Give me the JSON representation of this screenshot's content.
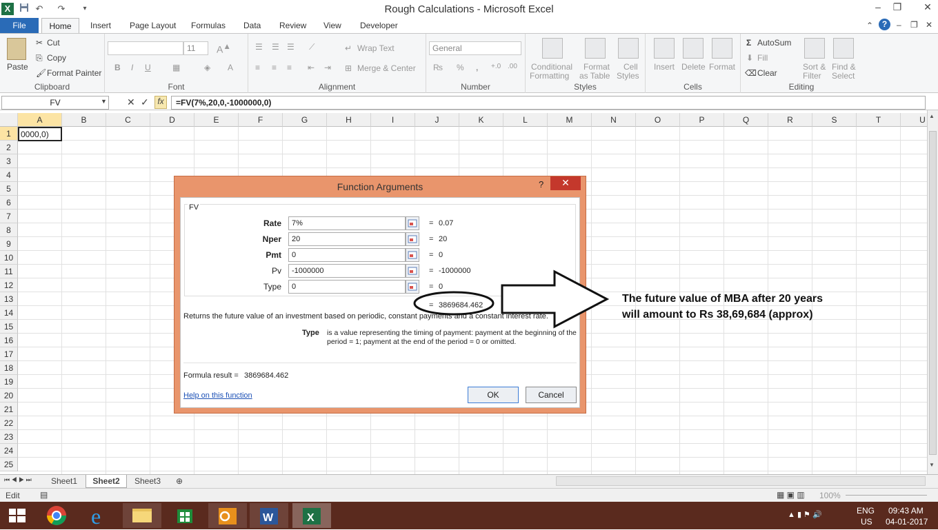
{
  "window": {
    "title": "Rough Calculations - Microsoft Excel",
    "minimize": "–",
    "restore": "❐",
    "close": "✕"
  },
  "tabs": {
    "file": "File",
    "home": "Home",
    "insert": "Insert",
    "page_layout": "Page Layout",
    "formulas": "Formulas",
    "data": "Data",
    "review": "Review",
    "view": "View",
    "developer": "Developer"
  },
  "ribbon": {
    "clipboard": {
      "paste": "Paste",
      "cut": "Cut",
      "copy": "Copy",
      "format_painter": "Format Painter",
      "label": "Clipboard"
    },
    "font": {
      "size": "11",
      "label": "Font",
      "bold": "B",
      "italic": "I",
      "underline": "U"
    },
    "alignment": {
      "wrap_text": "Wrap Text",
      "merge_center": "Merge & Center",
      "label": "Alignment"
    },
    "number": {
      "format": "General",
      "label": "Number",
      "percent": "%",
      "comma": ","
    },
    "styles": {
      "conditional": "Conditional",
      "formatting": "Formatting",
      "format_as": "Format",
      "as_table": "as Table",
      "cell": "Cell",
      "styles": "Styles",
      "label": "Styles"
    },
    "cells": {
      "insert": "Insert",
      "delete": "Delete",
      "format": "Format",
      "label": "Cells"
    },
    "editing": {
      "autosum": "AutoSum",
      "fill": "Fill",
      "clear": "Clear",
      "sort": "Sort &",
      "filter": "Filter",
      "find": "Find &",
      "select": "Select",
      "label": "Editing",
      "sigma": "Σ"
    }
  },
  "formula_bar": {
    "name_box": "FV",
    "cancel": "✕",
    "enter": "✓",
    "fx": "fx",
    "formula": "=FV(7%,20,0,-1000000,0)"
  },
  "columns": [
    "A",
    "B",
    "C",
    "D",
    "E",
    "F",
    "G",
    "H",
    "I",
    "J",
    "K",
    "L",
    "M",
    "N",
    "O",
    "P",
    "Q",
    "R",
    "S",
    "T",
    "U"
  ],
  "rows": [
    "1",
    "2",
    "3",
    "4",
    "5",
    "6",
    "7",
    "8",
    "9",
    "10",
    "11",
    "12",
    "13",
    "14",
    "15",
    "16",
    "17",
    "18",
    "19",
    "20",
    "21",
    "22",
    "23",
    "24",
    "25"
  ],
  "cell_a1": "0000,0)",
  "dialog": {
    "title": "Function Arguments",
    "help_mark": "?",
    "close": "✕",
    "function_name": "FV",
    "args": [
      {
        "label": "Rate",
        "value": "7%",
        "result": "0.07",
        "bold": true
      },
      {
        "label": "Nper",
        "value": "20",
        "result": "20",
        "bold": true
      },
      {
        "label": "Pmt",
        "value": "0",
        "result": "0",
        "bold": true
      },
      {
        "label": "Pv",
        "value": "-1000000",
        "result": "-1000000",
        "bold": false
      },
      {
        "label": "Type",
        "value": "0",
        "result": "0",
        "bold": false
      }
    ],
    "equals": "=",
    "total_result": "3869684.462",
    "description": "Returns the future value of an investment based on periodic, constant payments and a constant interest rate.",
    "type_label": "Type",
    "type_description": "is a value representing the timing of payment: payment at the beginning of the period = 1; payment at the end of the period = 0 or omitted.",
    "formula_result_label": "Formula result =",
    "formula_result": "3869684.462",
    "help_link": "Help on this function",
    "ok": "OK",
    "cancel": "Cancel"
  },
  "annotation": {
    "line1": "The future value of MBA after 20 years",
    "line2": "will amount to Rs 38,69,684 (approx)"
  },
  "sheets": [
    "Sheet1",
    "Sheet2",
    "Sheet3"
  ],
  "active_sheet": "Sheet2",
  "status": {
    "mode": "Edit",
    "zoom": "100%"
  },
  "taskbar": {
    "lang": "ENG",
    "region": "US",
    "time": "09:43 AM",
    "date": "04-01-2017"
  },
  "colors": {
    "dialog_frame": "#e9956c",
    "file_tab": "#2a6bb7",
    "close_red": "#c4382c",
    "taskbar": "#5a2a1e"
  }
}
